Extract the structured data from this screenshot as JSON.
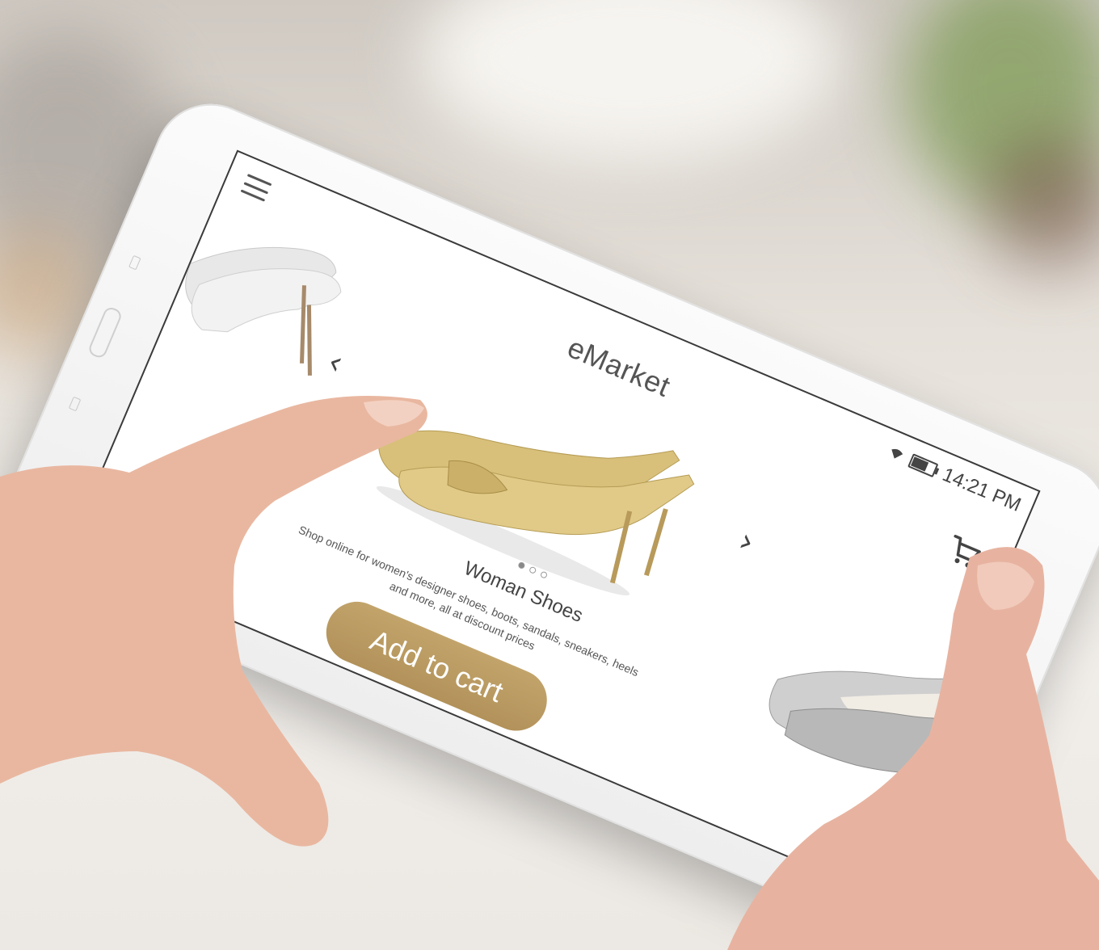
{
  "app": {
    "title": "eMarket"
  },
  "status_bar": {
    "time": "14:21 PM",
    "icons": [
      "wifi-icon",
      "battery-icon"
    ]
  },
  "header": {
    "menu_icon": "hamburger-menu-icon",
    "cart_icon": "shopping-cart-icon"
  },
  "carousel": {
    "prev_label": "‹",
    "next_label": "›",
    "page_count": 3,
    "active_page": 1,
    "product": {
      "title": "Woman Shoes",
      "description": "Shop online for women's designer shoes, boots, sandals, sneakers, heels and more, all at discount prices"
    },
    "add_to_cart_label": "Add to cart"
  },
  "colors": {
    "accent": "#b89a62",
    "screen_bg": "#ffffff",
    "text": "#555555"
  }
}
